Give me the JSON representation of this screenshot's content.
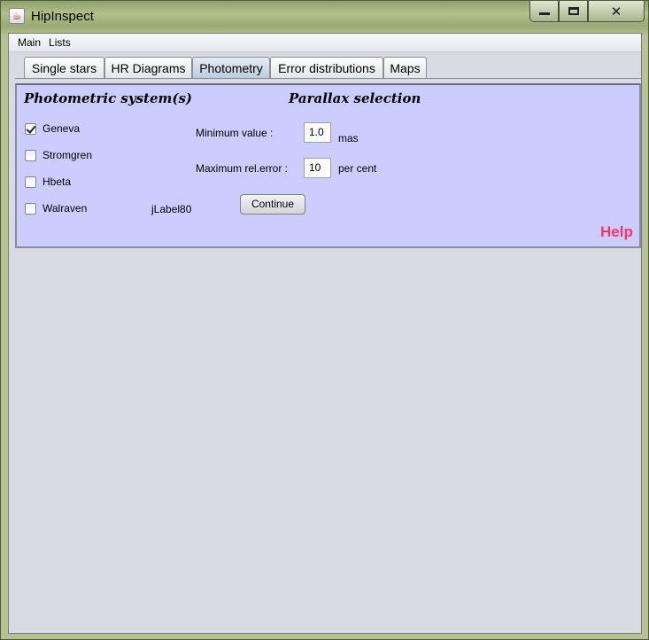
{
  "window": {
    "title": "HipInspect",
    "icon": "java-cup-icon",
    "buttons": {
      "minimize": "minimize-icon",
      "maximize": "maximize-icon",
      "close": "close-icon"
    }
  },
  "menu": {
    "items": [
      "Main",
      "Lists"
    ]
  },
  "tabs": [
    {
      "label": "Single stars"
    },
    {
      "label": "HR Diagrams"
    },
    {
      "label": "Photometry",
      "active": true
    },
    {
      "label": "Error distributions"
    },
    {
      "label": "Maps"
    }
  ],
  "panel": {
    "photometric_heading": "Photometric system(s)",
    "parallax_heading": "Parallax selection",
    "systems": [
      {
        "label": "Geneva",
        "checked": true
      },
      {
        "label": "Stromgren",
        "checked": false
      },
      {
        "label": "Hbeta",
        "checked": false
      },
      {
        "label": "Walraven",
        "checked": false
      }
    ],
    "extra_label": "jLabel80",
    "min_value": {
      "label": "Minimum value :",
      "value": "1.0",
      "unit": "mas"
    },
    "max_error": {
      "label": "Maximum rel.error :",
      "value": "10",
      "unit": "per cent"
    },
    "continue_label": "Continue",
    "help_label": "Help"
  },
  "colors": {
    "panel_bg": "#ccccff",
    "help": "#ff3366",
    "client_bg": "#d9dbe3"
  }
}
